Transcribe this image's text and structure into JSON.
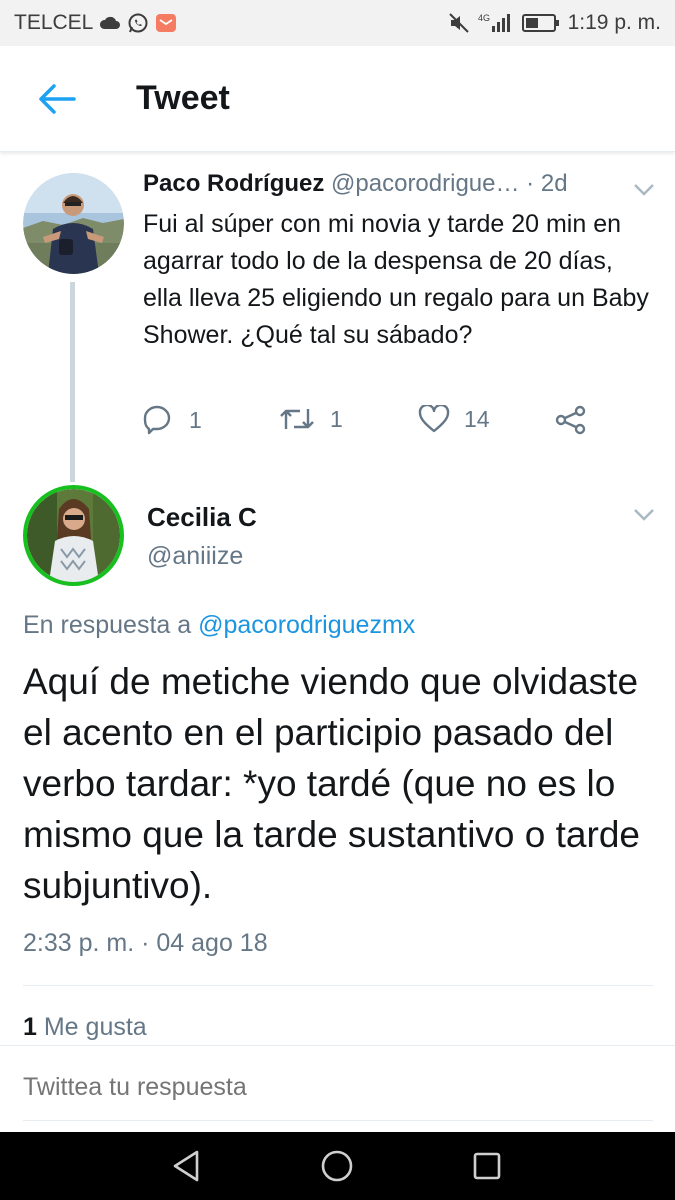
{
  "status_bar": {
    "carrier": "TELCEL",
    "network": "4G",
    "time": "1:19 p. m.",
    "icons": [
      "cloud-icon",
      "whatsapp-icon",
      "email-icon",
      "mute-icon",
      "signal-icon",
      "battery-icon"
    ]
  },
  "header": {
    "title": "Tweet"
  },
  "parent_tweet": {
    "name": "Paco Rodríguez",
    "handle": "@pacorodrigue…",
    "separator": "·",
    "time": "2d",
    "text": "Fui al súper con mi novia y tarde 20 min en agarrar todo lo de la despensa de 20 días, ella lleva 25 eligiendo un regalo para un Baby Shower. ¿Qué tal su sábado?",
    "actions": {
      "replies": "1",
      "retweets": "1",
      "likes": "14"
    }
  },
  "reply_tweet": {
    "name": "Cecilia C",
    "handle": "@aniiize",
    "in_reply_to_label": "En respuesta a",
    "in_reply_to_handle": "@pacorodriguezmx",
    "text": "Aquí de metiche viendo que olvidaste el acento en el participio pasado del verbo tardar: *yo tardé (que no es lo mismo que la tarde sustantivo o tarde subjuntivo).",
    "timestamp": "2:33 p. m. · 04 ago 18",
    "likes_count": "1",
    "likes_label": "Me gusta"
  },
  "compose": {
    "placeholder": "Twittea tu respuesta"
  },
  "colors": {
    "accent": "#1da1f2",
    "mention": "#1b95e0",
    "muted_text": "#657786",
    "primary_text": "#14171a",
    "avatar_ring": "#17bf1f"
  }
}
